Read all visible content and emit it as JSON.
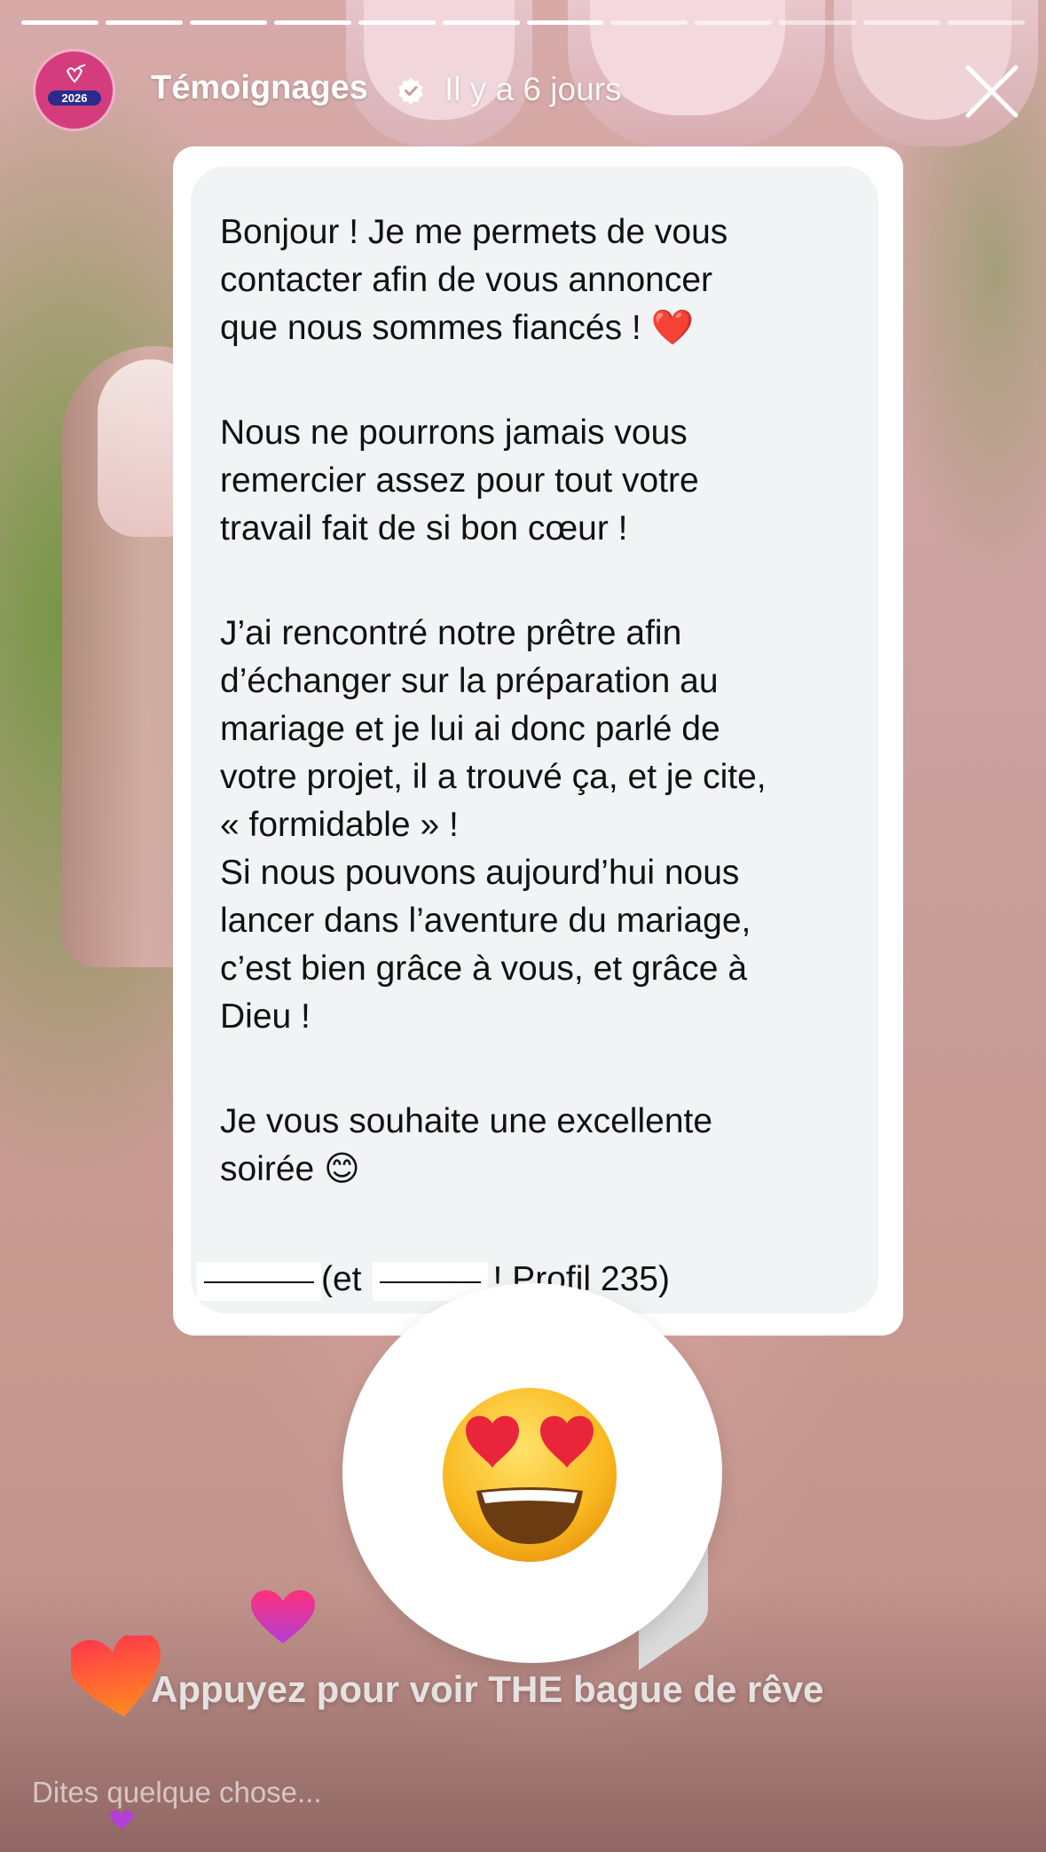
{
  "story": {
    "segments_total": 12,
    "segments_viewed": 7
  },
  "header": {
    "avatar_badge": "2026",
    "account_name": "Témoignages",
    "time_ago": "Il y a 6 jours"
  },
  "message": {
    "paragraphs": [
      [
        "Bonjour ! Je me permets de vous",
        "contacter afin de vous annoncer",
        "que nous sommes fiancés ! ❤️"
      ],
      [
        "Nous ne pourrons jamais vous",
        "remercier assez pour tout votre",
        "travail fait de si bon cœur !"
      ],
      [
        "J’ai rencontré notre prêtre afin",
        "d’échanger sur la préparation au",
        "mariage et je lui ai donc parlé de",
        "votre projet, il a trouvé ça, et je cite,",
        "« formidable » !",
        "Si nous pouvons aujourd’hui nous",
        "lancer dans l’aventure du mariage,",
        "c’est bien grâce à vous, et grâce à",
        "Dieu !"
      ],
      [
        "Je vous souhaite une excellente",
        "soirée 😊"
      ]
    ],
    "signature_open": "(et",
    "signature_close": "! Profil 235)"
  },
  "sticker": {
    "emoji": "heart-eyes-emoji"
  },
  "footer": {
    "cta": "Appuyez pour voir THE bague de rêve",
    "reply_placeholder": "Dites quelque chose..."
  },
  "colors": {
    "avatar_bg": "#d43c7d",
    "avatar_badge_bg": "#2a2b8c",
    "bubble_bg": "#f2f3f5",
    "heart_red": "#ff3b4a",
    "heart_orange": "#ff8a1f",
    "heart_pink": "#ff2f7a",
    "heart_purple": "#b23fd6"
  },
  "icons": [
    "verified-badge-icon",
    "close-icon",
    "heart-icon"
  ]
}
